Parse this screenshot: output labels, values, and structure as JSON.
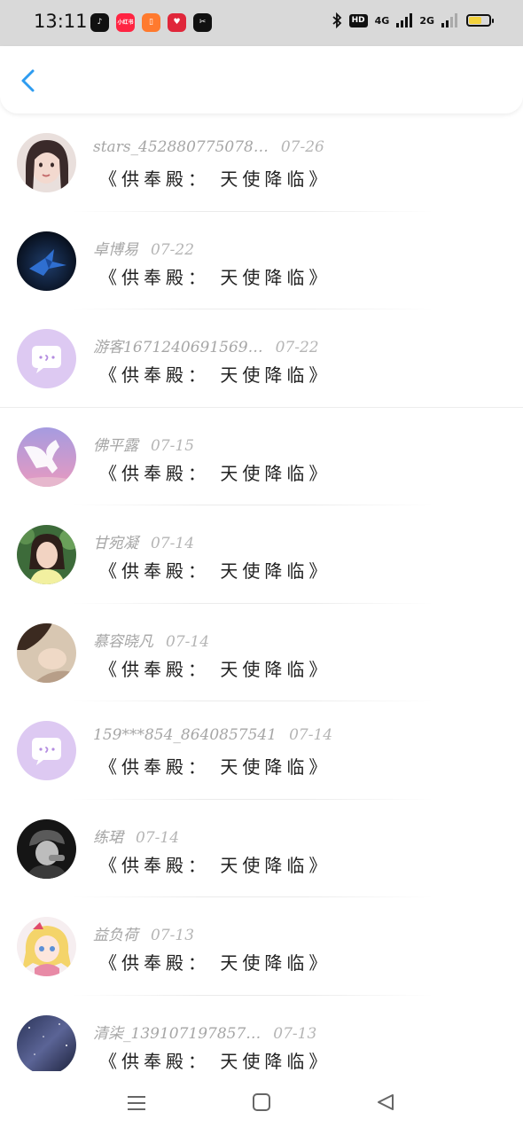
{
  "status_bar": {
    "time": "13:11",
    "apps": [
      {
        "icon": "tiktok-icon",
        "label": "♪",
        "color": "#111111"
      },
      {
        "icon": "app-icon",
        "label": "小红书",
        "color": "#ff2442"
      },
      {
        "icon": "book-app-icon",
        "label": "▯",
        "color": "#ff7a2e"
      },
      {
        "icon": "heart-app-icon",
        "label": "♥",
        "color": "#e0263a"
      },
      {
        "icon": "capcut-icon",
        "label": "✂",
        "color": "#111111"
      }
    ],
    "hd_label": "HD",
    "net1_label": "4G",
    "net2_label": "2G"
  },
  "header": {
    "back_icon": "chevron-left-icon",
    "back_color": "#2e9cf0"
  },
  "messages": [
    {
      "name": "stars_452880775078…",
      "date": "07-26",
      "text": "《供奉殿： 天使降临》",
      "avatar": "girl-photo"
    },
    {
      "name": "卓博易",
      "date": "07-22",
      "text": "《供奉殿： 天使降临》",
      "avatar": "paper-crane"
    },
    {
      "name": "游客1671240691569…",
      "date": "07-22",
      "text": "《供奉殿： 天使降临》",
      "avatar": "default-chat"
    },
    {
      "name": "佛平露",
      "date": "07-15",
      "text": "《供奉殿： 天使降临》",
      "avatar": "pegasus"
    },
    {
      "name": "甘宛凝",
      "date": "07-14",
      "text": "《供奉殿： 天使降临》",
      "avatar": "girl-garden"
    },
    {
      "name": "慕容晓凡",
      "date": "07-14",
      "text": "《供奉殿： 天使降临》",
      "avatar": "sepia-photo"
    },
    {
      "name": "159***854_8640857541",
      "date": "07-14",
      "text": "《供奉殿： 天使降临》",
      "avatar": "default-chat"
    },
    {
      "name": "练珺",
      "date": "07-14",
      "text": "《供奉殿： 天使降临》",
      "avatar": "bw-photo"
    },
    {
      "name": "益负荷",
      "date": "07-13",
      "text": "《供奉殿： 天使降临》",
      "avatar": "anime-girl"
    },
    {
      "name": "清柒_139107197857…",
      "date": "07-13",
      "text": "《供奉殿： 天使降临》",
      "avatar": "night-sky"
    }
  ],
  "nav": {
    "menu_icon": "menu-icon",
    "home_icon": "home-square-icon",
    "back_icon": "back-triangle-icon"
  }
}
